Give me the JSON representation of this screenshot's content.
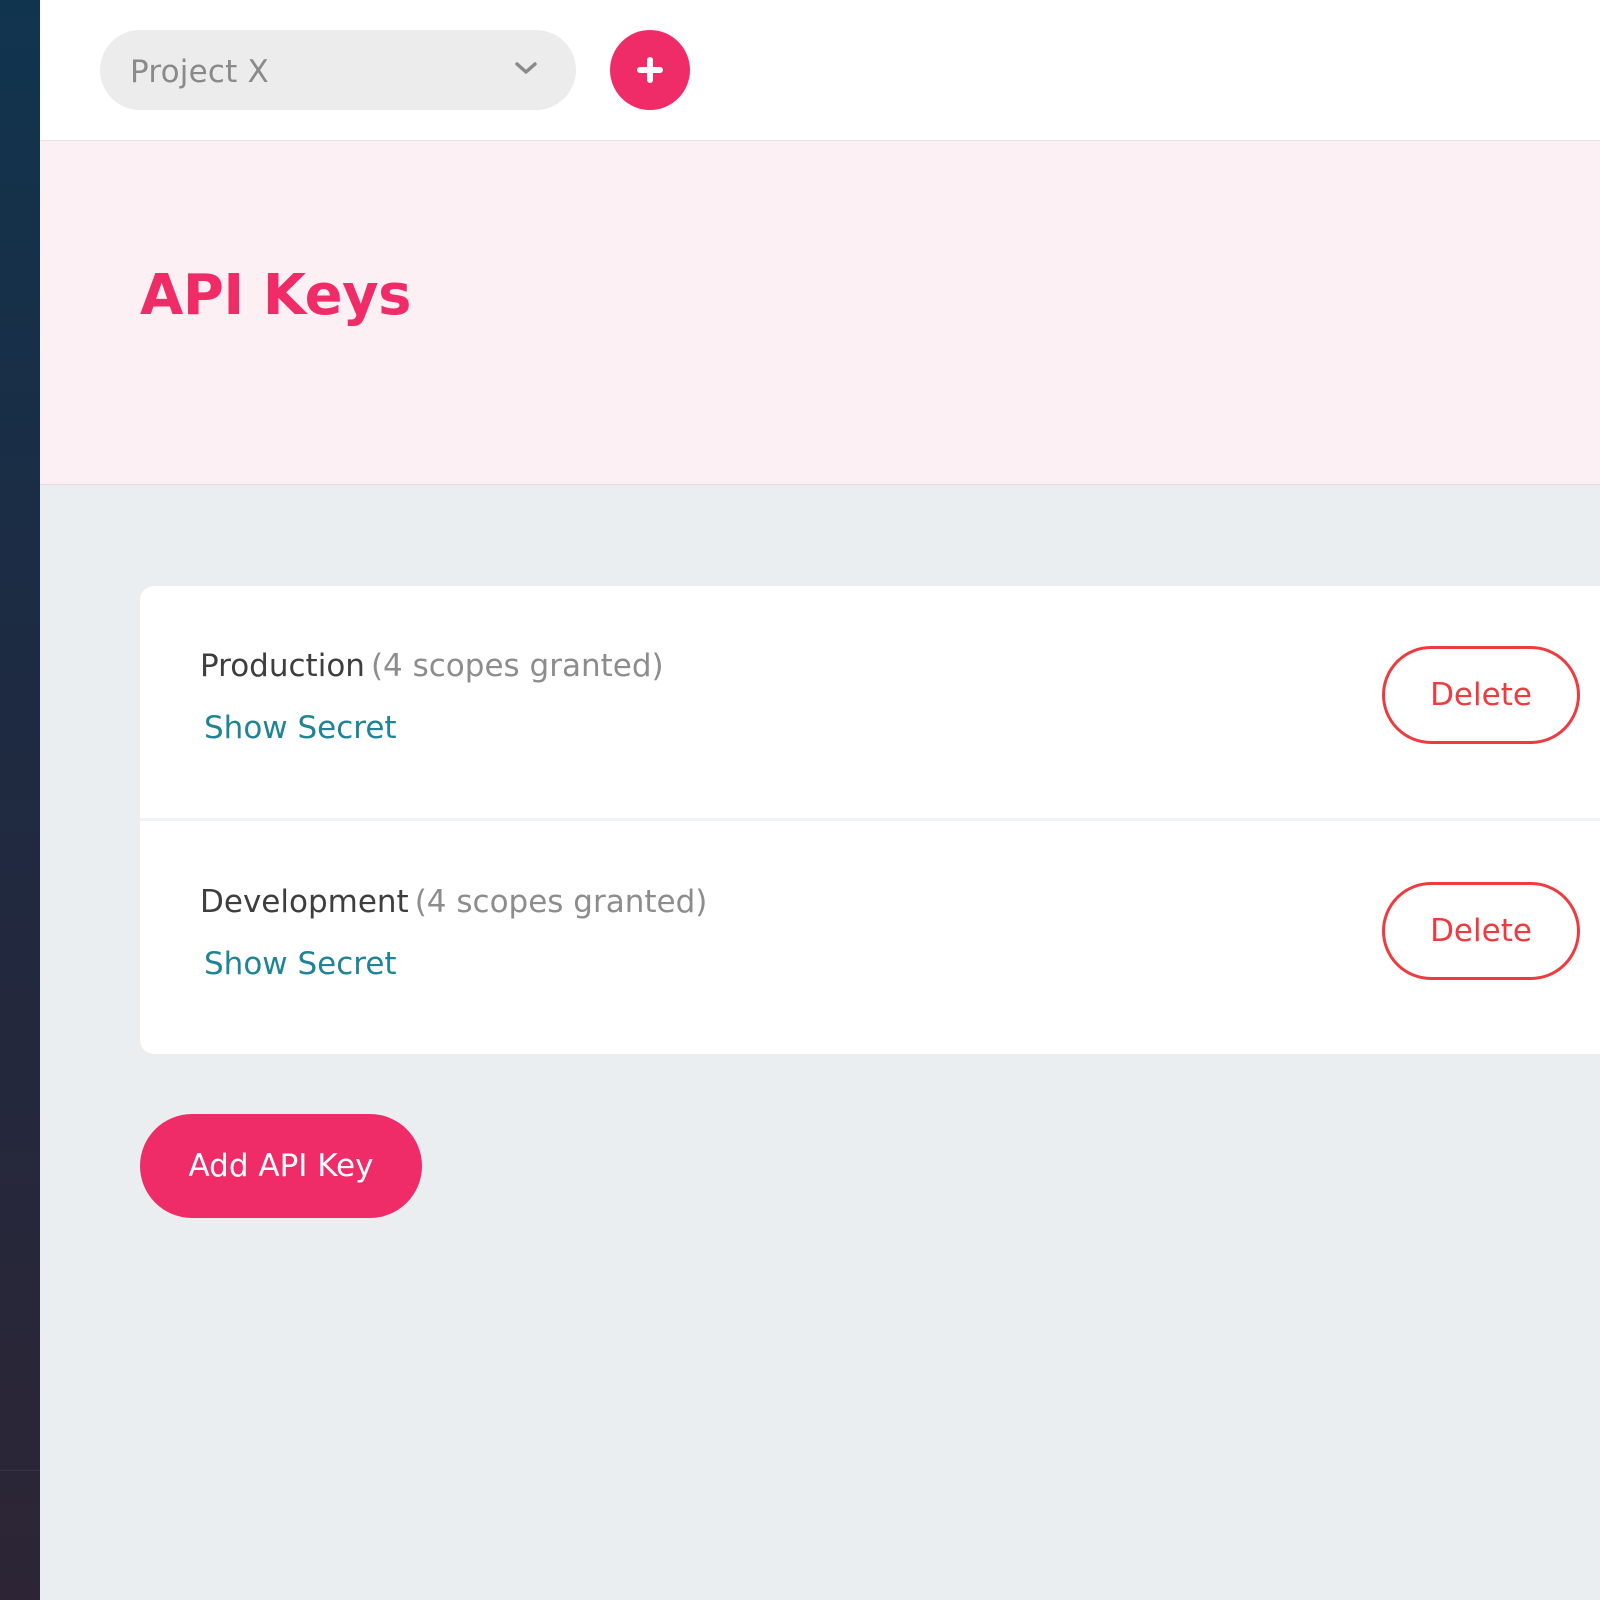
{
  "header": {
    "project_selector": {
      "value": "Project X"
    }
  },
  "page": {
    "title": "API Keys"
  },
  "api_keys": [
    {
      "name": "Production",
      "scopes": "(4 scopes granted)",
      "show_secret_label": "Show Secret",
      "delete_label": "Delete"
    },
    {
      "name": "Development",
      "scopes": "(4 scopes granted)",
      "show_secret_label": "Show Secret",
      "delete_label": "Delete"
    }
  ],
  "actions": {
    "add_key_label": "Add API Key"
  },
  "icons": {
    "project_dropdown": "chevron-down-icon",
    "add_project": "plus-icon"
  },
  "colors": {
    "accent": "#ef2c68",
    "danger": "#ee3b3f",
    "link": "#1f8496",
    "hero_background": "#fdf0f4",
    "page_background": "#ebeef1",
    "sidebar_top": "#11344e",
    "sidebar_bottom": "#2d2535"
  }
}
